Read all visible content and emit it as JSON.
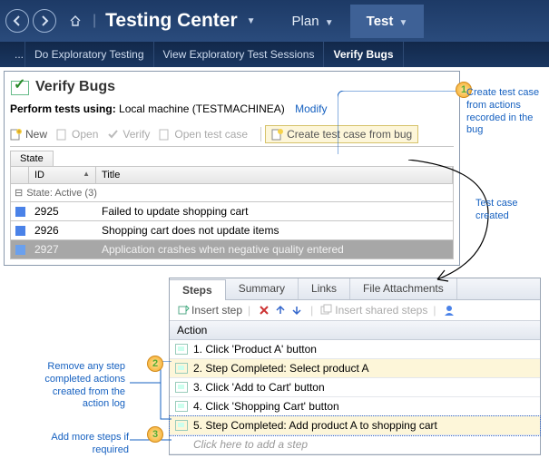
{
  "topbar": {
    "app_title": "Testing Center",
    "tabs": {
      "plan": "Plan",
      "test": "Test"
    }
  },
  "subbar": {
    "overflow": "...",
    "items": [
      "Do Exploratory Testing",
      "View Exploratory Test Sessions",
      "Verify Bugs"
    ]
  },
  "panel": {
    "title": "Verify Bugs",
    "perform_label": "Perform tests using:",
    "perform_value": "Local machine (TESTMACHINEA)",
    "modify": "Modify"
  },
  "toolbar": {
    "new": "New",
    "open": "Open",
    "verify": "Verify",
    "open_test_case": "Open test case",
    "create_from_bug": "Create test case from bug"
  },
  "grid": {
    "state_btn": "State",
    "col_id": "ID",
    "col_title": "Title",
    "group_label": "State: Active (3)",
    "rows": [
      {
        "id": "2925",
        "title": "Failed to update shopping cart"
      },
      {
        "id": "2926",
        "title": "Shopping cart does not update items"
      },
      {
        "id": "2927",
        "title": "Application crashes when negative quality entered"
      }
    ]
  },
  "callouts": {
    "c1": "Create test case from actions recorded in the bug",
    "c1a": "Test case created",
    "c2": "Remove any step completed actions created from the action log",
    "c3": "Add more steps if required"
  },
  "steps": {
    "tabs": [
      "Steps",
      "Summary",
      "Links",
      "File Attachments"
    ],
    "insert_step": "Insert step",
    "insert_shared": "Insert shared steps",
    "action_hdr": "Action",
    "rows": [
      "1. Click 'Product A' button",
      "2. Step Completed: Select product A",
      "3. Click 'Add to Cart' button",
      "4. Click 'Shopping Cart' button",
      "5. Step Completed: Add product A to shopping cart"
    ],
    "placeholder": "Click here to add a step"
  }
}
